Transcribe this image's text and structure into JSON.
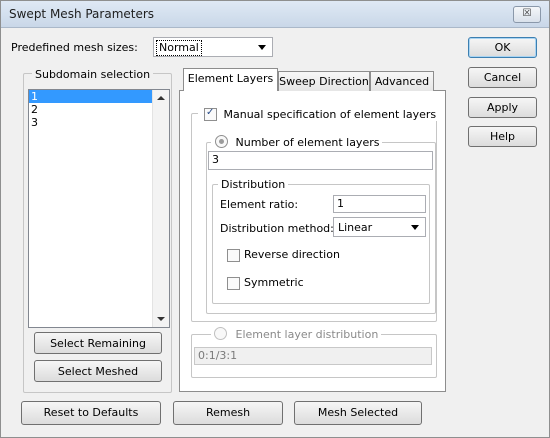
{
  "window": {
    "title": "Swept Mesh Parameters",
    "close_glyph": "☒"
  },
  "mesh_sizes": {
    "label": "Predefined mesh sizes:",
    "value": "Normal"
  },
  "subdomain": {
    "title": "Subdomain selection",
    "items": [
      "1",
      "2",
      "3"
    ],
    "selected_index": 0
  },
  "side_buttons": {
    "select_remaining": "Select Remaining",
    "select_meshed": "Select Meshed"
  },
  "dialog_buttons": {
    "ok": "OK",
    "cancel": "Cancel",
    "apply": "Apply",
    "help": "Help"
  },
  "bottom_buttons": {
    "reset": "Reset to Defaults",
    "remesh": "Remesh",
    "mesh_selected": "Mesh Selected"
  },
  "tabs": [
    {
      "label": "Element Layers",
      "active": true
    },
    {
      "label": "Sweep Direction",
      "active": false
    },
    {
      "label": "Advanced",
      "active": false
    }
  ],
  "element_layers": {
    "manual_label": "Manual specification of element layers",
    "manual_checked": true,
    "number_label": "Number of element layers",
    "number_selected": true,
    "number_value": "3",
    "distribution": {
      "title": "Distribution",
      "ratio_label": "Element ratio:",
      "ratio_value": "1",
      "method_label": "Distribution method:",
      "method_value": "Linear",
      "reverse_label": "Reverse direction",
      "reverse_checked": false,
      "symmetric_label": "Symmetric",
      "symmetric_checked": false
    },
    "layer_dist_label": "Element layer distribution",
    "layer_dist_value": "0:1/3:1"
  }
}
